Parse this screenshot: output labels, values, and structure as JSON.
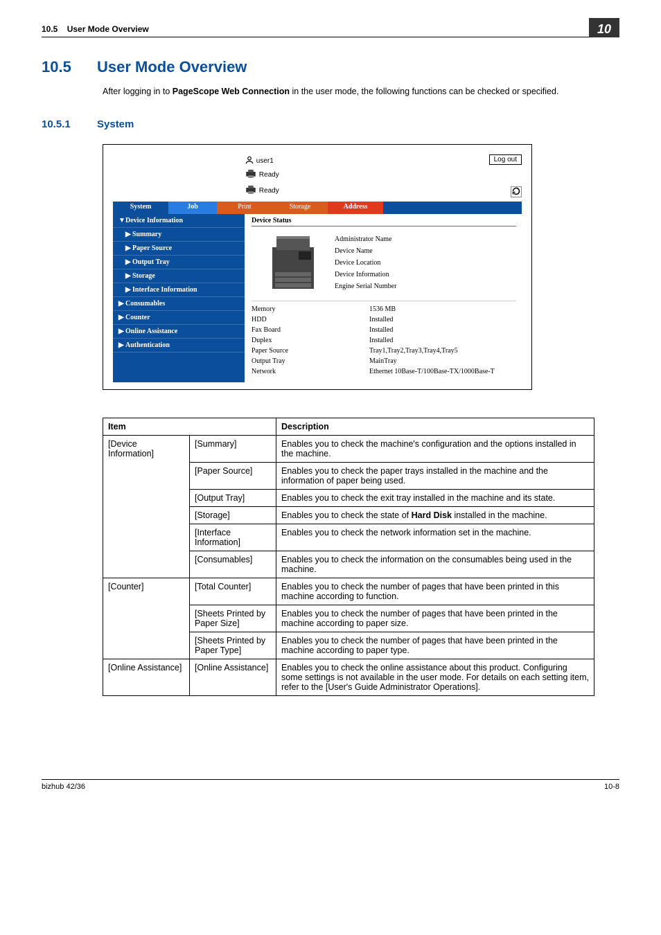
{
  "runhead": {
    "section_no": "10.5",
    "section_title": "User Mode Overview",
    "chapter": "10"
  },
  "heading": {
    "num": "10.5",
    "title": "User Mode Overview"
  },
  "intro_pre": "After logging in to ",
  "intro_bold": "PageScope Web Connection",
  "intro_post": " in the user mode, the following functions can be checked or specified.",
  "subheading": {
    "num": "10.5.1",
    "title": "System"
  },
  "shot": {
    "user": "user1",
    "logout": "Log out",
    "ready": "Ready",
    "tabs": {
      "system": "System",
      "job": "Job",
      "print": "Print",
      "storage": "Storage",
      "address": "Address"
    },
    "sidebar": {
      "dev_info": "Device Information",
      "summary": "Summary",
      "paper_source": "Paper Source",
      "output_tray": "Output Tray",
      "storage": "Storage",
      "iface": "Interface Information",
      "consumables": "Consumables",
      "counter": "Counter",
      "online": "Online Assistance",
      "auth": "Authentication"
    },
    "content": {
      "title": "Device Status",
      "labels": {
        "admin": "Administrator Name",
        "devname": "Device Name",
        "devloc": "Device Location",
        "devinfo": "Device Information",
        "serial": "Engine Serial Number"
      },
      "rows": [
        {
          "k": "Memory",
          "v": "1536 MB"
        },
        {
          "k": "HDD",
          "v": "Installed"
        },
        {
          "k": "Fax Board",
          "v": "Installed"
        },
        {
          "k": "Duplex",
          "v": "Installed"
        },
        {
          "k": "Paper Source",
          "v": "Tray1,Tray2,Tray3,Tray4,Tray5"
        },
        {
          "k": "Output Tray",
          "v": "MainTray"
        },
        {
          "k": "Network",
          "v": "Ethernet 10Base-T/100Base-TX/1000Base-T"
        }
      ]
    }
  },
  "table": {
    "head_item": "Item",
    "head_desc": "Description",
    "rows": [
      {
        "cat": "[Device Information]",
        "sub": "[Summary]",
        "desc": "Enables you to check the machine's configuration and the options installed in the machine."
      },
      {
        "cat": "",
        "sub": "[Paper Source]",
        "desc": "Enables you to check the paper trays installed in the machine and the information of paper being used."
      },
      {
        "cat": "",
        "sub": "[Output Tray]",
        "desc": "Enables you to check the exit tray installed in the machine and its state."
      },
      {
        "cat": "",
        "sub": "[Storage]",
        "desc_pre": "Enables you to check the state of ",
        "desc_bold": "Hard Disk",
        "desc_post": " installed in the machine."
      },
      {
        "cat": "",
        "sub": "[Interface Information]",
        "desc": "Enables you to check the network information set in the machine."
      },
      {
        "cat": "",
        "sub": "[Consumables]",
        "desc": "Enables you to check the information on the consumables being used in the machine."
      },
      {
        "cat": "[Counter]",
        "sub": "[Total Counter]",
        "desc": "Enables you to check the number of pages that have been printed in this machine according to function."
      },
      {
        "cat": "",
        "sub": "[Sheets Printed by Paper Size]",
        "desc": "Enables you to check the number of pages that have been printed in the machine according to paper size."
      },
      {
        "cat": "",
        "sub": "[Sheets Printed by Paper Type]",
        "desc": "Enables you to check the number of pages that have been printed in the machine according to paper type."
      },
      {
        "cat": "[Online Assistance]",
        "sub": "[Online Assistance]",
        "desc": "Enables you to check the online assistance about this product. Configuring some settings is not available in the user mode. For details on each setting item, refer to the [User's Guide Administrator Operations]."
      }
    ]
  },
  "footer": {
    "left": "bizhub 42/36",
    "right": "10-8"
  }
}
